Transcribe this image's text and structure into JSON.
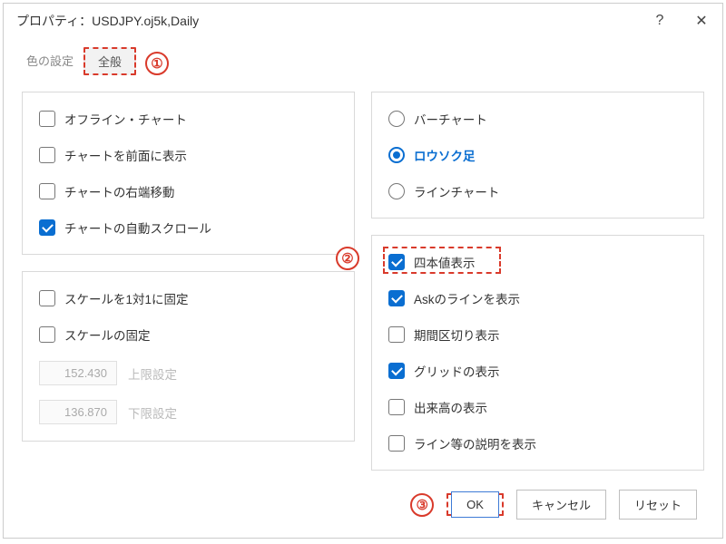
{
  "titlebar": {
    "title": "プロパティ：USDJPY.oj5k,Daily",
    "help": "?",
    "close": "✕"
  },
  "tabs": {
    "color_settings": "色の設定",
    "general": "全般"
  },
  "annotations": {
    "one": "①",
    "two": "②",
    "three": "③"
  },
  "left": {
    "chart_group": {
      "offline": "オフライン・チャート",
      "foreground": "チャートを前面に表示",
      "shift_right": "チャートの右端移動",
      "autoscroll": "チャートの自動スクロール"
    },
    "scale_group": {
      "one_to_one": "スケールを1対1に固定",
      "fixed": "スケールの固定",
      "upper": {
        "value": "152.430",
        "label": "上限設定"
      },
      "lower": {
        "value": "136.870",
        "label": "下限設定"
      }
    }
  },
  "right": {
    "chart_type": {
      "bar": "バーチャート",
      "candle": "ロウソク足",
      "line": "ラインチャート"
    },
    "display": {
      "ohlc": "四本値表示",
      "ask_line": "Askのラインを表示",
      "periods": "期間区切り表示",
      "grid": "グリッドの表示",
      "volumes": "出来高の表示",
      "descriptions": "ライン等の説明を表示"
    }
  },
  "footer": {
    "ok": "OK",
    "cancel": "キャンセル",
    "reset": "リセット"
  }
}
